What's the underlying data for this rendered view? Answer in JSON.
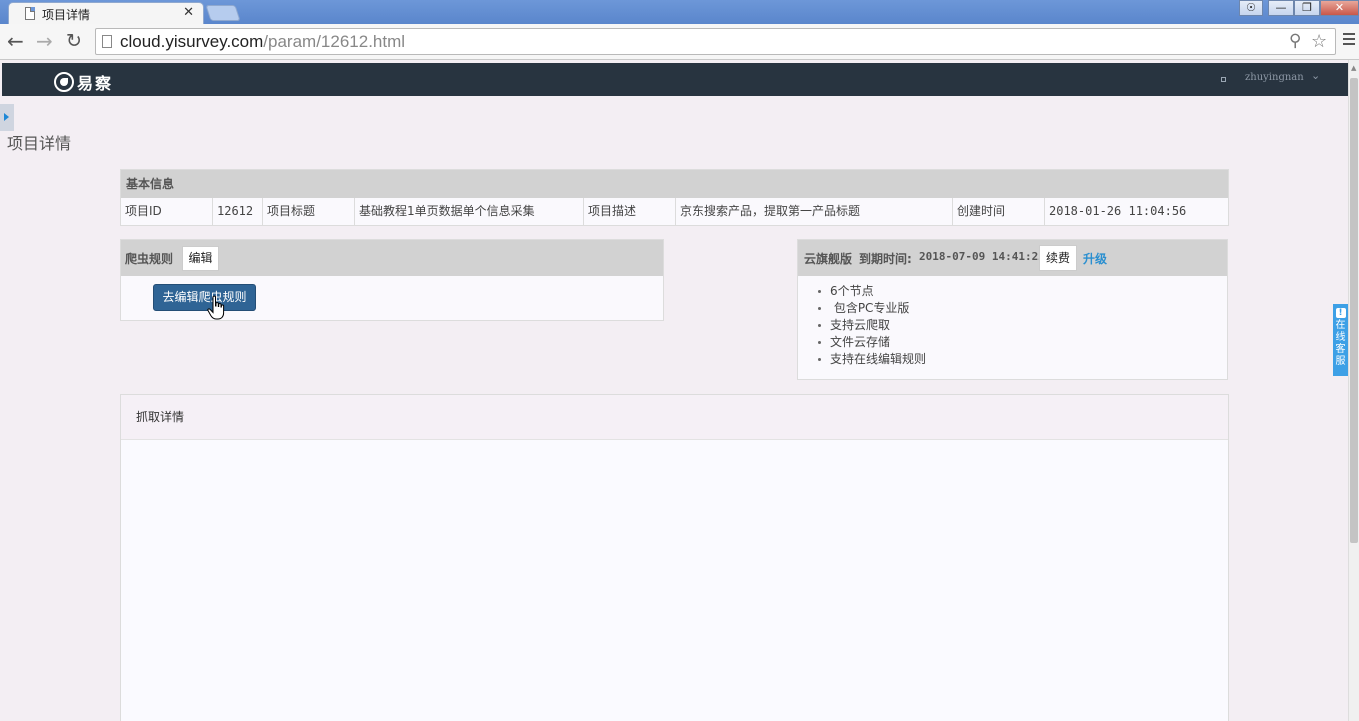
{
  "browser": {
    "tab_title": "项目详情",
    "tab_close": "✕",
    "url_host": "cloud.yisurvey.com",
    "url_path": "/param/12612.html"
  },
  "header": {
    "logo_text": "易察",
    "username": "zhuyingnan"
  },
  "page": {
    "title": "项目详情"
  },
  "basic_info": {
    "heading": "基本信息",
    "fields": {
      "id_label": "项目ID",
      "id_value": "12612",
      "title_label": "项目标题",
      "title_value": "基础教程1单页数据单个信息采集",
      "desc_label": "项目描述",
      "desc_value": "京东搜索产品，提取第一产品标题",
      "created_label": "创建时间",
      "created_value": "2018-01-26 11:04:56"
    }
  },
  "crawler_rules": {
    "heading": "爬虫规则",
    "edit_label": "编辑",
    "go_edit_label": "去编辑爬虫规则"
  },
  "plan": {
    "name": "云旗舰版",
    "expire_label": "到期时间:",
    "expire_value": "2018-07-09 14:41:22",
    "renew_label": "续费",
    "upgrade_label": "升级",
    "features": [
      "6个节点",
      " 包含PC专业版",
      "支持云爬取",
      "文件云存储",
      "支持在线编辑规则"
    ]
  },
  "crawl_detail": {
    "heading": "抓取详情"
  },
  "service": {
    "label": "在线客服",
    "alert": "!"
  },
  "colors": {
    "header_bg": "#283440",
    "primary_button": "#2f6495",
    "link": "#2a8fd0",
    "service_tab": "#3da0e6"
  }
}
